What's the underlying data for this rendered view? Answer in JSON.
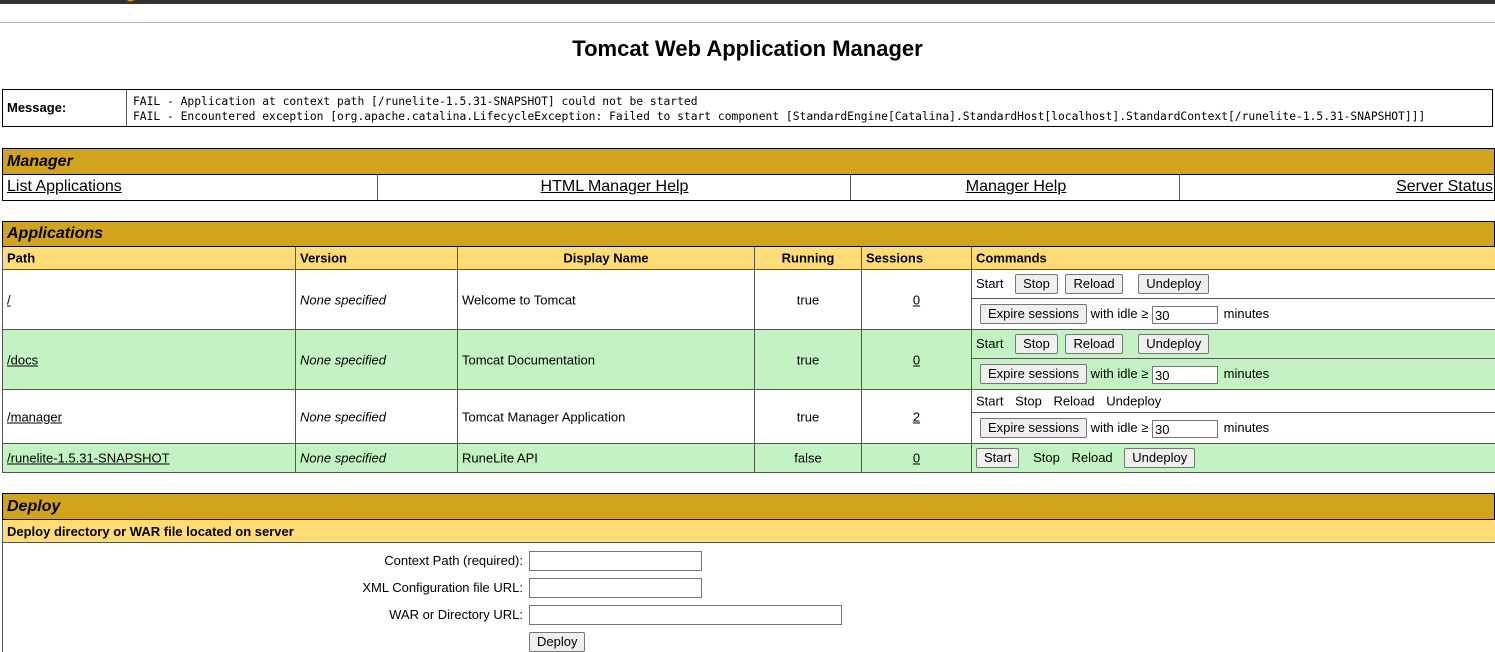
{
  "page": {
    "title": "Tomcat Web Application Manager"
  },
  "message": {
    "label": "Message:",
    "lines": [
      "FAIL - Application at context path [/runelite-1.5.31-SNAPSHOT] could not be started",
      "FAIL - Encountered exception [org.apache.catalina.LifecycleException: Failed to start component [StandardEngine[Catalina].StandardHost[localhost].StandardContext[/runelite-1.5.31-SNAPSHOT]]]"
    ]
  },
  "manager": {
    "heading": "Manager",
    "links": [
      "List Applications",
      "HTML Manager Help",
      "Manager Help",
      "Server Status"
    ]
  },
  "applications": {
    "heading": "Applications",
    "columns": [
      "Path",
      "Version",
      "Display Name",
      "Running",
      "Sessions",
      "Commands"
    ],
    "rows": [
      {
        "path": "/",
        "version": "None specified",
        "display_name": "Welcome to Tomcat",
        "running": "true",
        "sessions": "0"
      },
      {
        "path": "/docs",
        "version": "None specified",
        "display_name": "Tomcat Documentation",
        "running": "true",
        "sessions": "0"
      },
      {
        "path": "/manager",
        "version": "None specified",
        "display_name": "Tomcat Manager Application",
        "running": "true",
        "sessions": "2"
      },
      {
        "path": "/runelite-1.5.31-SNAPSHOT",
        "version": "None specified",
        "display_name": "RuneLite API",
        "running": "false",
        "sessions": "0"
      }
    ],
    "commands": {
      "start": "Start",
      "stop": "Stop",
      "reload": "Reload",
      "undeploy": "Undeploy",
      "expire": "Expire sessions",
      "with_idle": "with idle ≥",
      "idle_value": "30",
      "minutes": "minutes"
    }
  },
  "deploy": {
    "heading": "Deploy",
    "subheading": "Deploy directory or WAR file located on server",
    "context_label": "Context Path (required):",
    "xml_label": "XML Configuration file URL:",
    "war_label": "WAR or Directory URL:",
    "button": "Deploy"
  },
  "colors": {
    "section_header": "#d2a41c",
    "subheader": "#ffdc75",
    "row_alt": "#c3f3c3"
  }
}
